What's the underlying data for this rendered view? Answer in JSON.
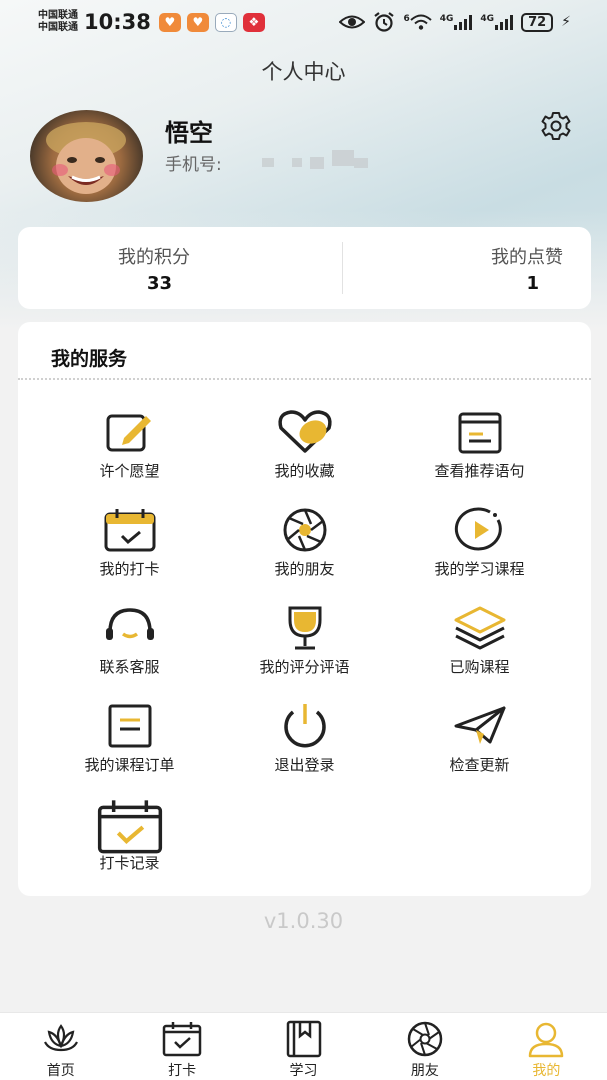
{
  "status_bar": {
    "carrier_1": "中国联通",
    "carrier_2": "中国联通",
    "time": "10:38",
    "signal_label_1": "4G",
    "signal_label_2": "4G",
    "wifi_label": "6",
    "battery": "72"
  },
  "header": {
    "title": "个人中心"
  },
  "profile": {
    "name": "悟空",
    "phone_label": "手机号:",
    "settings_icon": "gear-icon"
  },
  "stats": {
    "points_label": "我的积分",
    "points_value": "33",
    "likes_label": "我的点赞",
    "likes_value": "1"
  },
  "services": {
    "title": "我的服务",
    "items": [
      {
        "label": "许个愿望",
        "icon": "edit-icon"
      },
      {
        "label": "我的收藏",
        "icon": "heart-icon"
      },
      {
        "label": "查看推荐语句",
        "icon": "book-icon"
      },
      {
        "label": "我的打卡",
        "icon": "calendar-check-icon"
      },
      {
        "label": "我的朋友",
        "icon": "aperture-icon"
      },
      {
        "label": "我的学习课程",
        "icon": "play-icon"
      },
      {
        "label": "联系客服",
        "icon": "headset-icon"
      },
      {
        "label": "我的评分评语",
        "icon": "trophy-icon"
      },
      {
        "label": "已购课程",
        "icon": "layers-icon"
      },
      {
        "label": "我的课程订单",
        "icon": "order-icon"
      },
      {
        "label": "退出登录",
        "icon": "power-icon"
      },
      {
        "label": "检查更新",
        "icon": "paper-plane-icon"
      },
      {
        "label": "打卡记录",
        "icon": "calendar-record-icon"
      }
    ]
  },
  "version": "v1.0.30",
  "tabs": [
    {
      "label": "首页",
      "icon": "lotus-icon",
      "active": false
    },
    {
      "label": "打卡",
      "icon": "calendar-check-icon",
      "active": false
    },
    {
      "label": "学习",
      "icon": "notebook-icon",
      "active": false
    },
    {
      "label": "朋友",
      "icon": "aperture-icon",
      "active": false
    },
    {
      "label": "我的",
      "icon": "user-icon",
      "active": true
    }
  ],
  "colors": {
    "accent": "#e8b732",
    "icon_stroke": "#222222",
    "background": "#f2f2f2"
  }
}
